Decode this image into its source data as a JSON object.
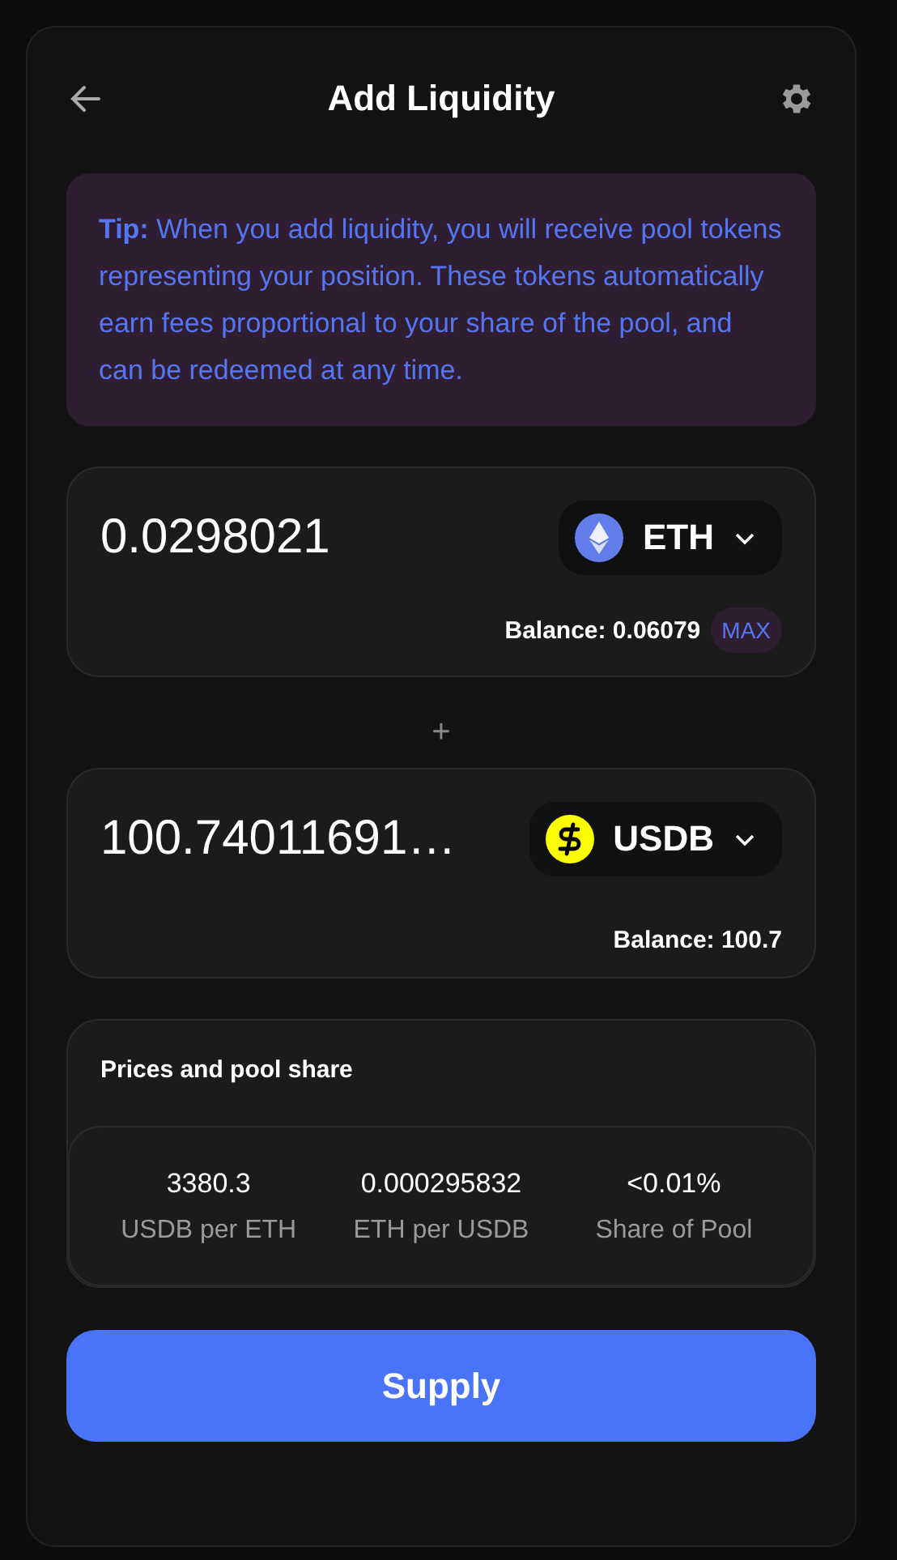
{
  "header": {
    "title": "Add Liquidity"
  },
  "tip": {
    "text": "**Tip:** When you add liquidity, you will receive pool tokens representing your position. These tokens automatically earn fees proportional to your share of the pool, and can be redeemed at any time."
  },
  "inputs": [
    {
      "value": "0.0298021",
      "token": "ETH",
      "kind": "eth",
      "balance": "Balance: 0.06079",
      "max": "MAX"
    },
    {
      "value": "100.74011691…",
      "token": "USDB",
      "kind": "usdb",
      "balance": "Balance: 100.7"
    }
  ],
  "separator": "+",
  "prices": {
    "title": "Prices and pool share",
    "stats": [
      {
        "value": "3380.3",
        "label": "USDB per ETH"
      },
      {
        "value": "0.000295832",
        "label": "ETH per USDB"
      },
      {
        "value": "<0.01%",
        "label": "Share of Pool"
      }
    ]
  },
  "supply_button": "Supply"
}
